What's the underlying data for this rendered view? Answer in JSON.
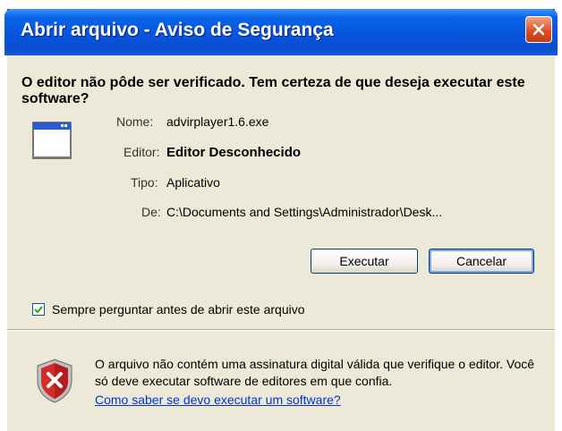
{
  "window": {
    "title": "Abrir arquivo - Aviso de Segurança"
  },
  "headline": "O editor não pôde ser verificado.  Tem certeza de que deseja executar este software?",
  "file_info": {
    "name_label": "Nome:",
    "name_value": "advirplayer1.6.exe",
    "publisher_label": "Editor:",
    "publisher_value": "Editor Desconhecido",
    "type_label": "Tipo:",
    "type_value": "Aplicativo",
    "from_label": "De:",
    "from_value": "C:\\Documents and Settings\\Administrador\\Desk..."
  },
  "buttons": {
    "run": "Executar",
    "cancel": "Cancelar"
  },
  "always_ask": {
    "label": "Sempre perguntar antes de abrir este arquivo",
    "checked": true
  },
  "warning": {
    "text": "O arquivo não contém uma assinatura digital válida que verifique o editor.  Você só deve executar software de editores em que confia.",
    "link": "Como saber se devo executar um software?"
  },
  "icons": {
    "app": "application-window-icon",
    "shield": "security-shield-icon",
    "close": "close-icon",
    "check": "checkmark-icon"
  },
  "colors": {
    "titlebar": "#0855dd",
    "close_button": "#dc4a1d",
    "dialog_bg": "#ece9d8",
    "link": "#0033cc"
  }
}
